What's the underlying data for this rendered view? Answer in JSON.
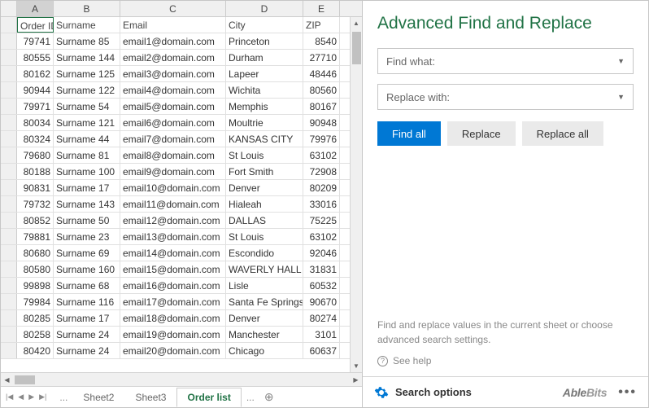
{
  "columns": [
    "A",
    "B",
    "C",
    "D",
    "E"
  ],
  "headers": {
    "A": "Order ID",
    "B": "Surname",
    "C": "Email",
    "D": "City",
    "E": "ZIP"
  },
  "rows": [
    {
      "A": "79741",
      "B": "Surname 85",
      "C": "email1@domain.com",
      "D": "Princeton",
      "E": "8540"
    },
    {
      "A": "80555",
      "B": "Surname 144",
      "C": "email2@domain.com",
      "D": "Durham",
      "E": "27710"
    },
    {
      "A": "80162",
      "B": "Surname 125",
      "C": "email3@domain.com",
      "D": "Lapeer",
      "E": "48446"
    },
    {
      "A": "90944",
      "B": "Surname 122",
      "C": "email4@domain.com",
      "D": "Wichita",
      "E": "80560"
    },
    {
      "A": "79971",
      "B": "Surname 54",
      "C": "email5@domain.com",
      "D": "Memphis",
      "E": "80167"
    },
    {
      "A": "80034",
      "B": "Surname 121",
      "C": "email6@domain.com",
      "D": "Moultrie",
      "E": "90948"
    },
    {
      "A": "80324",
      "B": "Surname 44",
      "C": "email7@domain.com",
      "D": "KANSAS CITY",
      "E": "79976"
    },
    {
      "A": "79680",
      "B": "Surname 81",
      "C": "email8@domain.com",
      "D": "St Louis",
      "E": "63102"
    },
    {
      "A": "80188",
      "B": "Surname 100",
      "C": "email9@domain.com",
      "D": "Fort Smith",
      "E": "72908"
    },
    {
      "A": "90831",
      "B": "Surname 17",
      "C": "email10@domain.com",
      "D": "Denver",
      "E": "80209"
    },
    {
      "A": "79732",
      "B": "Surname 143",
      "C": "email11@domain.com",
      "D": "Hialeah",
      "E": "33016"
    },
    {
      "A": "80852",
      "B": "Surname 50",
      "C": "email12@domain.com",
      "D": "DALLAS",
      "E": "75225"
    },
    {
      "A": "79881",
      "B": "Surname 23",
      "C": "email13@domain.com",
      "D": "St Louis",
      "E": "63102"
    },
    {
      "A": "80680",
      "B": "Surname 69",
      "C": "email14@domain.com",
      "D": "Escondido",
      "E": "92046"
    },
    {
      "A": "80580",
      "B": "Surname 160",
      "C": "email15@domain.com",
      "D": "WAVERLY HALL",
      "E": "31831"
    },
    {
      "A": "99898",
      "B": "Surname 68",
      "C": "email16@domain.com",
      "D": "Lisle",
      "E": "60532"
    },
    {
      "A": "79984",
      "B": "Surname 116",
      "C": "email17@domain.com",
      "D": "Santa Fe Springs",
      "E": "90670"
    },
    {
      "A": "80285",
      "B": "Surname 17",
      "C": "email18@domain.com",
      "D": "Denver",
      "E": "80274"
    },
    {
      "A": "80258",
      "B": "Surname 24",
      "C": "email19@domain.com",
      "D": "Manchester",
      "E": "3101"
    },
    {
      "A": "80420",
      "B": "Surname 24",
      "C": "email20@domain.com",
      "D": "Chicago",
      "E": "60637"
    }
  ],
  "tabs": {
    "items": [
      "Sheet2",
      "Sheet3",
      "Order list"
    ],
    "active": "Order list"
  },
  "panel": {
    "title": "Advanced Find and Replace",
    "find_label": "Find what:",
    "replace_label": "Replace with:",
    "buttons": {
      "find": "Find all",
      "replace": "Replace",
      "replace_all": "Replace all"
    },
    "hint": "Find and replace values in the current sheet or choose advanced search settings.",
    "help": "See help",
    "options": "Search options",
    "brand1": "Able",
    "brand2": "Bits"
  }
}
